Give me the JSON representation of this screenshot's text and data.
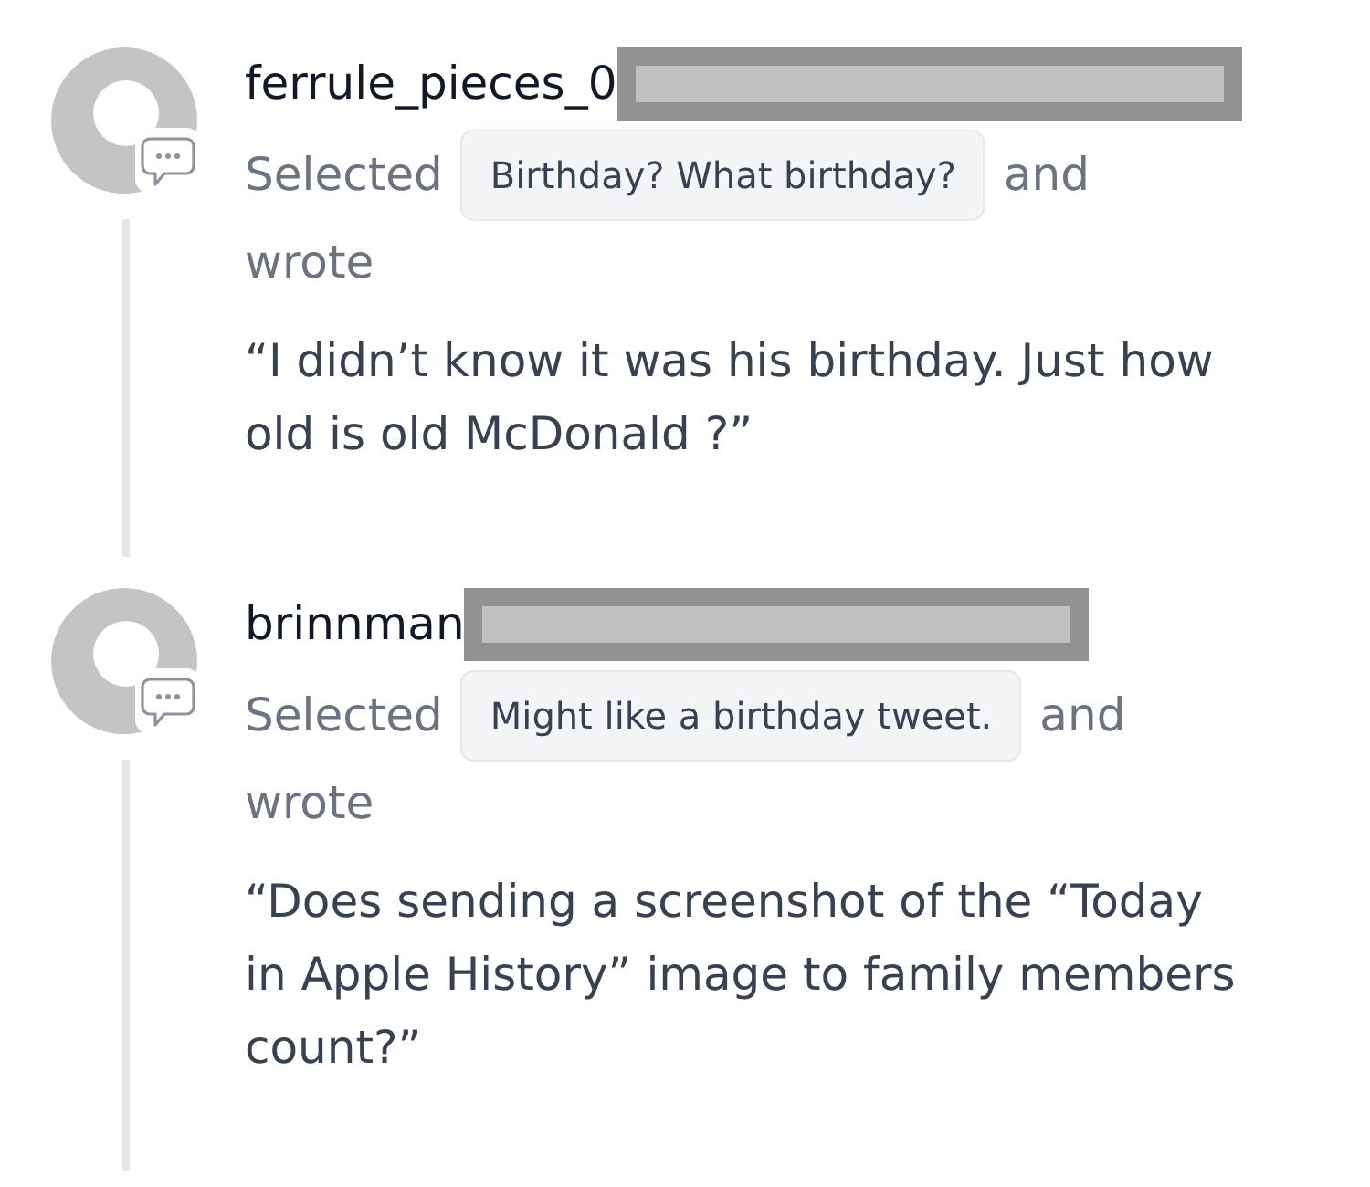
{
  "comments": [
    {
      "author": {
        "name": "ferrule_pieces_0",
        "redacted": true
      },
      "action": {
        "lead": "Selected",
        "selection": "Birthday? What birthday?",
        "connector": "and",
        "verb": "wrote"
      },
      "quote": "“I didn’t know it was his birthday. Just how old is old McDonald ?”"
    },
    {
      "author": {
        "name": "brinnman",
        "redacted": true
      },
      "action": {
        "lead": "Selected",
        "selection": "Might like a birthday tweet.",
        "connector": "and",
        "verb": "wrote"
      },
      "quote": "“Does sending a screenshot of the “Today in Apple History” image to family members count?”"
    }
  ]
}
